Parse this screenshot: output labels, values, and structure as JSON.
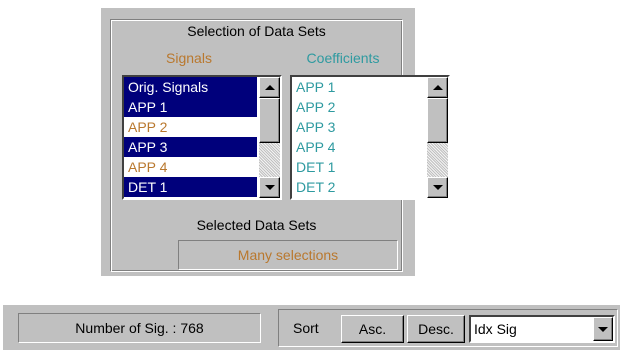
{
  "selection": {
    "title": "Selection of Data Sets",
    "signals_title": "Signals",
    "coefficients_title": "Coefficients",
    "selected_label": "Selected Data Sets",
    "selected_value": "Many selections"
  },
  "signals_list": {
    "items": [
      {
        "label": "Orig. Signals",
        "selected": true
      },
      {
        "label": "APP 1",
        "selected": true
      },
      {
        "label": "APP 2",
        "selected": false
      },
      {
        "label": "APP 3",
        "selected": true
      },
      {
        "label": "APP 4",
        "selected": false
      },
      {
        "label": "DET 1",
        "selected": true
      }
    ]
  },
  "coefficients_list": {
    "items": [
      {
        "label": "APP 1"
      },
      {
        "label": "APP 2"
      },
      {
        "label": "APP 3"
      },
      {
        "label": "APP 4"
      },
      {
        "label": "DET 1"
      },
      {
        "label": "DET 2"
      }
    ]
  },
  "bottom": {
    "num_sig": "Number of Sig. : 768",
    "sort_label": "Sort",
    "asc_label": "Asc.",
    "desc_label": "Desc.",
    "sort_select_value": "Idx Sig"
  },
  "colors": {
    "panel": "#c0c0c0",
    "selection_bg": "#00007b",
    "signals_text": "#b9782e",
    "coefficients_text": "#2e9aa0"
  },
  "icons": {
    "scroll_up": "triangle-up-icon",
    "scroll_down": "triangle-down-icon",
    "dropdown": "chevron-down-icon"
  }
}
